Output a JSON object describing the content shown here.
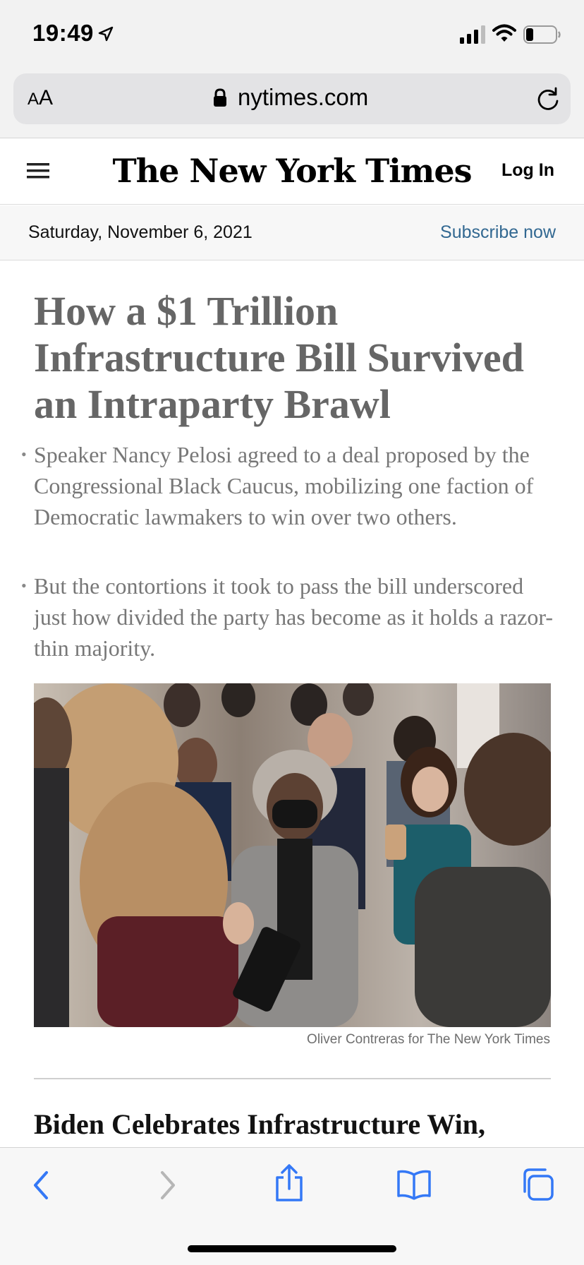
{
  "status_bar": {
    "time": "19:49",
    "location_icon": "location-arrow-icon",
    "signal_icon": "cellular-signal-icon",
    "wifi_icon": "wifi-icon",
    "battery_icon": "battery-icon",
    "battery_level": 0.25
  },
  "browser": {
    "text_size_label_small": "A",
    "text_size_label_large": "A",
    "url": "nytimes.com",
    "lock_icon": "lock-icon",
    "reload_icon": "reload-icon"
  },
  "header": {
    "menu_icon": "hamburger-menu-icon",
    "logo": "The New York Times",
    "login_label": "Log In"
  },
  "date_bar": {
    "date": "Saturday, November 6, 2021",
    "subscribe_label": "Subscribe now"
  },
  "article": {
    "headline": "How a $1 Trillion Infrastructure Bill Survived an Intraparty Brawl",
    "summary": [
      "Speaker Nancy Pelosi agreed to a deal proposed by the Congressional Black Caucus, mobilizing one faction of Democratic lawmakers to win over two others.",
      "But the contortions it took to pass the bill underscored just how divided the party has become as it holds a razor-thin majority."
    ],
    "photo_credit": "Oliver Contreras for The New York Times"
  },
  "next_article": {
    "headline": "Biden Celebrates Infrastructure Win,"
  },
  "toolbar": {
    "back_icon": "back-chevron-icon",
    "forward_icon": "forward-chevron-icon",
    "share_icon": "share-icon",
    "bookmarks_icon": "bookmarks-book-icon",
    "tabs_icon": "tabs-icon"
  },
  "colors": {
    "link_blue": "#326891",
    "system_blue": "#3478f6",
    "headline_gray": "#666666"
  }
}
